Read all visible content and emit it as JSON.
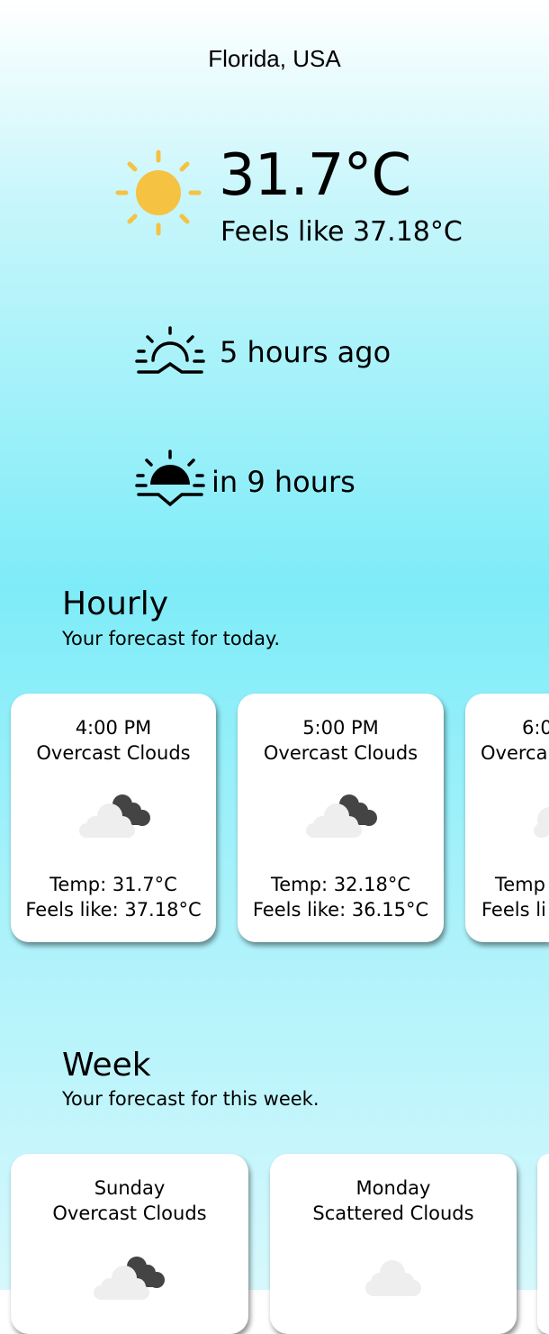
{
  "location": "Florida, USA",
  "current": {
    "temperature": "31.7°C",
    "feels_like": "Feels like 37.18°C",
    "icon": "sun-icon"
  },
  "sunrise": {
    "icon": "sunrise-icon",
    "text": "5 hours ago"
  },
  "sunset": {
    "icon": "sunset-icon",
    "text": "in 9 hours"
  },
  "hourly": {
    "title": "Hourly",
    "subtitle": "Your forecast for today.",
    "cards": [
      {
        "time": "4:00 PM",
        "desc": "Overcast Clouds",
        "icon": "overcast-clouds-icon",
        "temp": "Temp: 31.7°C",
        "feels": "Feels like: 37.18°C"
      },
      {
        "time": "5:00 PM",
        "desc": "Overcast Clouds",
        "icon": "overcast-clouds-icon",
        "temp": "Temp: 32.18°C",
        "feels": "Feels like: 36.15°C"
      },
      {
        "time": "6:0",
        "desc": "Overca",
        "icon": "overcast-clouds-icon",
        "temp": "Temp",
        "feels": "Feels li"
      }
    ]
  },
  "week": {
    "title": "Week",
    "subtitle": "Your forecast for this week.",
    "cards": [
      {
        "day": "Sunday",
        "desc": "Overcast Clouds",
        "icon": "overcast-clouds-icon"
      },
      {
        "day": "Monday",
        "desc": "Scattered Clouds",
        "icon": "scattered-clouds-icon"
      }
    ]
  },
  "colors": {
    "sun": "#f5c242",
    "cloud_light": "#eeeeee",
    "cloud_dark": "#444444",
    "card_bg": "#ffffff",
    "sky_top": "#ffffff",
    "sky_bottom": "#7eecf8"
  }
}
